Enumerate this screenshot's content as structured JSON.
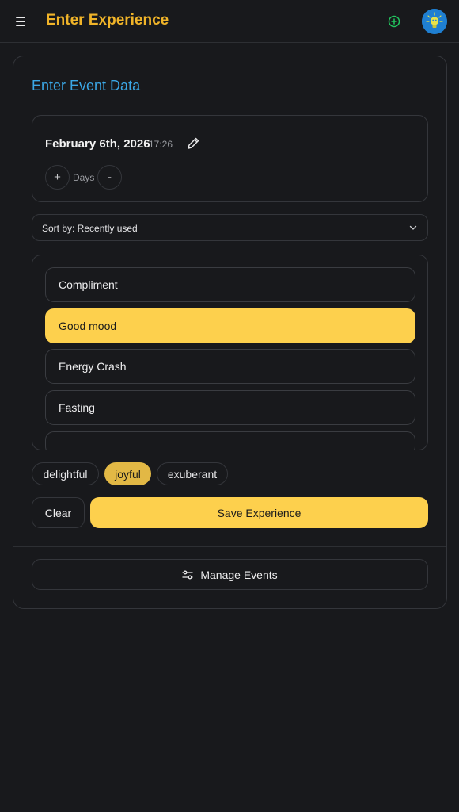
{
  "header": {
    "title": "Enter Experience",
    "menu_icon": "hamburger-menu-icon",
    "add_icon": "plus-circle-icon",
    "avatar_icon": "lightbulb-avatar-icon",
    "title_color": "#f0b429",
    "add_color": "#22c55e"
  },
  "form": {
    "title": "Enter Event Data",
    "title_color": "#3ba7e6",
    "date": "February 6th, 2026",
    "time": "17:26",
    "edit_icon": "pencil-icon",
    "days_label": "Days",
    "increment_label": "+",
    "decrement_label": "-",
    "sort_label": "Sort by: Recently used",
    "sort_icon": "chevron-down-icon"
  },
  "events": [
    {
      "label": "Compliment",
      "selected": false
    },
    {
      "label": "Good mood",
      "selected": true
    },
    {
      "label": "Energy Crash",
      "selected": false
    },
    {
      "label": "Fasting",
      "selected": false
    }
  ],
  "tags": [
    {
      "label": "delightful",
      "selected": false
    },
    {
      "label": "joyful",
      "selected": true
    },
    {
      "label": "exuberant",
      "selected": false
    }
  ],
  "actions": {
    "clear_label": "Clear",
    "save_label": "Save Experience",
    "manage_label": "Manage Events",
    "manage_icon": "sliders-icon",
    "accent_color": "#fdd04d"
  }
}
